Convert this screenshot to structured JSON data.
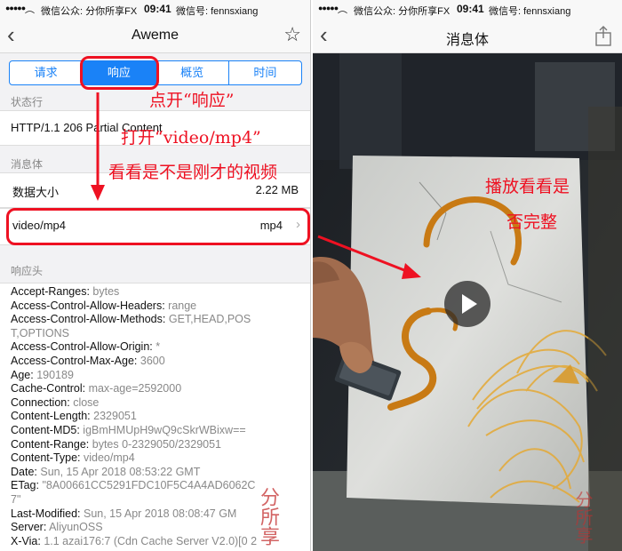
{
  "status_bar": {
    "carrier": "微信公众: 分你所享FX",
    "time": "09:41",
    "wechat_id": "微信号: fennsxiang"
  },
  "left_screen": {
    "nav_title": "Aweme",
    "tabs": [
      "请求",
      "响应",
      "概览",
      "时间"
    ],
    "active_tab": "响应",
    "status_section": "状态行",
    "status_line": "HTTP/1.1 206 Partial Content",
    "body_section": "消息体",
    "data_size_label": "数据大小",
    "data_size_value": "2.22 MB",
    "body_type_label": "video/mp4",
    "body_type_value": "mp4",
    "headers_section": "响应头",
    "headers": [
      {
        "k": "Accept-Ranges:",
        "v": "bytes"
      },
      {
        "k": "Access-Control-Allow-Headers:",
        "v": "range"
      },
      {
        "k": "Access-Control-Allow-Methods:",
        "v": "GET,HEAD,POS"
      },
      {
        "k": "",
        "v": "T,OPTIONS"
      },
      {
        "k": "Access-Control-Allow-Origin:",
        "v": "*"
      },
      {
        "k": "Access-Control-Max-Age:",
        "v": "3600"
      },
      {
        "k": "Age:",
        "v": "190189"
      },
      {
        "k": "Cache-Control:",
        "v": "max-age=2592000"
      },
      {
        "k": "Connection:",
        "v": "close"
      },
      {
        "k": "Content-Length:",
        "v": "2329051"
      },
      {
        "k": "Content-MD5:",
        "v": "igBmHMUpH9wQ9cSkrWBixw=="
      },
      {
        "k": "Content-Range:",
        "v": "bytes 0-2329050/2329051"
      },
      {
        "k": "Content-Type:",
        "v": "video/mp4"
      },
      {
        "k": "Date:",
        "v": "Sun, 15 Apr 2018 08:53:22 GMT"
      },
      {
        "k": "ETag:",
        "v": "\"8A00661CC5291FDC10F5C4A4AD6062C"
      },
      {
        "k": "",
        "v": "7\""
      },
      {
        "k": "Last-Modified:",
        "v": "Sun, 15 Apr 2018 08:08:47 GM"
      },
      {
        "k": "Server:",
        "v": "AliyunOSS"
      },
      {
        "k": "X-Via:",
        "v": "1.1 azai176:7 (Cdn Cache Server V2.0)[0 2"
      }
    ],
    "annotations": {
      "open_response": "点开“响应”",
      "open_video": "打开“video/mp4”",
      "check_video": "看看是不是刚才的视频"
    }
  },
  "right_screen": {
    "nav_title": "消息体",
    "annotations": {
      "play_line1": "播放看看是",
      "play_line2": "否完整"
    }
  },
  "watermark": "分所享",
  "colors": {
    "accent": "#1a82f7",
    "annotation_red": "#ee1122",
    "syrup": "#c87a14"
  },
  "icons": [
    "back-icon",
    "star-icon",
    "share-icon",
    "play-icon",
    "chevron-right-icon",
    "wifi-icon",
    "signal-icon"
  ]
}
